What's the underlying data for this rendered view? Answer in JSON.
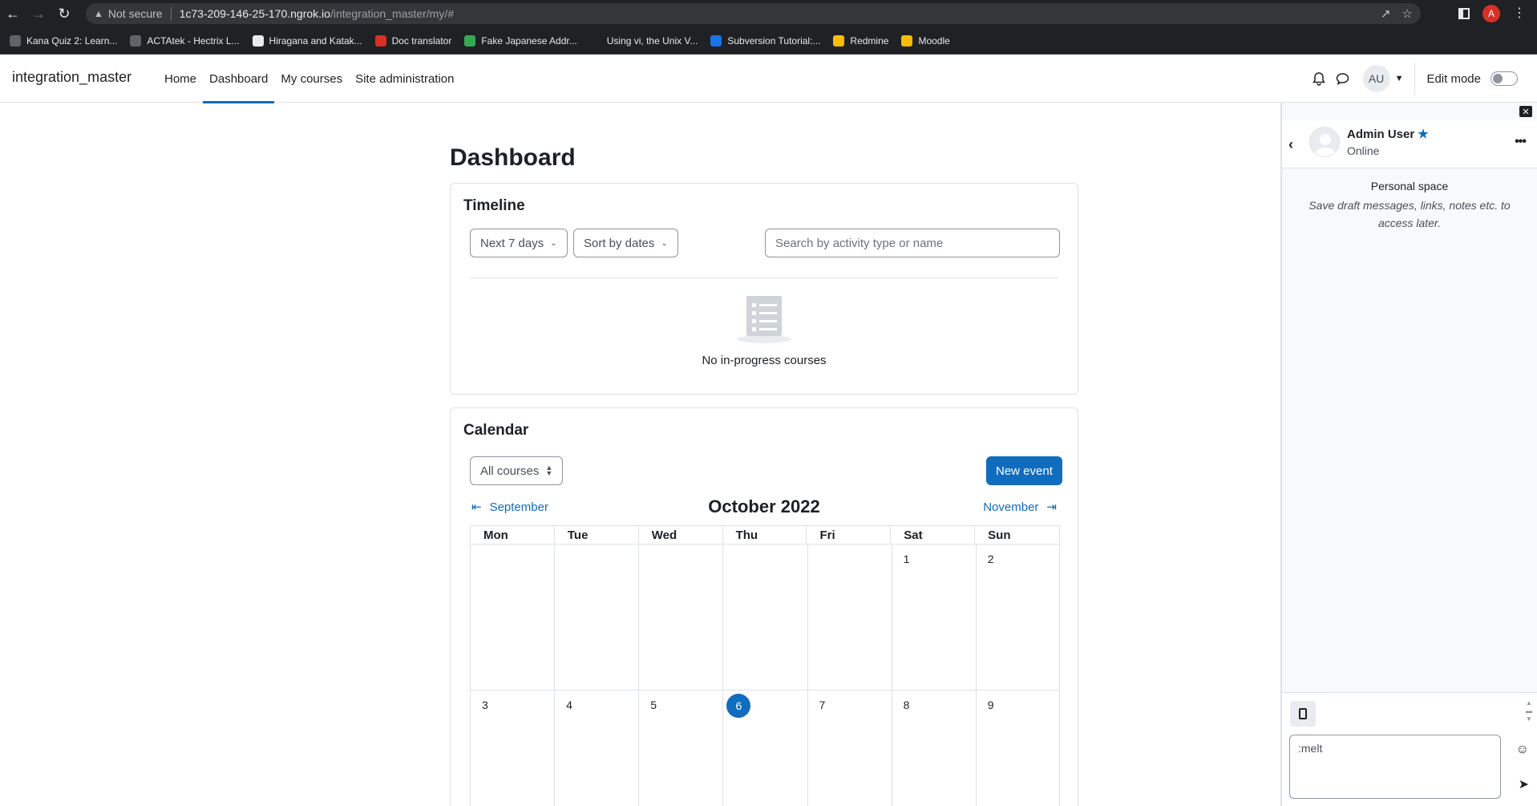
{
  "browser": {
    "not_secure": "Not secure",
    "url_host": "1c73-209-146-25-170.ngrok.io",
    "url_path": "/integration_master/my/#",
    "profile_initial": "A",
    "bookmarks": [
      {
        "label": "Kana Quiz 2: Learn...",
        "color": "#5f6368"
      },
      {
        "label": "ACTAtek - Hectrix L...",
        "color": "#5f6368"
      },
      {
        "label": "Hiragana and Katak...",
        "color": "#e8eaed"
      },
      {
        "label": "Doc translator",
        "color": "#d93025"
      },
      {
        "label": "Fake Japanese Addr...",
        "color": "#34a853"
      },
      {
        "label": "Using vi, the Unix V...",
        "color": "#202124"
      },
      {
        "label": "Subversion Tutorial:...",
        "color": "#1a73e8"
      },
      {
        "label": "Redmine",
        "color": "#fbbc04"
      },
      {
        "label": "Moodle",
        "color": "#fbbc04"
      }
    ]
  },
  "navbar": {
    "site_name": "integration_master",
    "items": [
      "Home",
      "Dashboard",
      "My courses",
      "Site administration"
    ],
    "active_index": 1,
    "avatar_initials": "AU",
    "edit_mode_label": "Edit mode"
  },
  "page": {
    "title": "Dashboard"
  },
  "timeline": {
    "title": "Timeline",
    "filter_days": "Next 7 days",
    "sort": "Sort by dates",
    "search_placeholder": "Search by activity type or name",
    "empty_text": "No in-progress courses"
  },
  "calendar": {
    "title": "Calendar",
    "course_filter": "All courses",
    "new_event": "New event",
    "prev_month": "September",
    "next_month": "November",
    "month_title": "October 2022",
    "weekdays": [
      "Mon",
      "Tue",
      "Wed",
      "Thu",
      "Fri",
      "Sat",
      "Sun"
    ],
    "weeks": [
      [
        "",
        "",
        "",
        "",
        "",
        "1",
        "2"
      ],
      [
        "3",
        "4",
        "5",
        "6",
        "7",
        "8",
        "9"
      ]
    ],
    "today": "6"
  },
  "drawer": {
    "user_name": "Admin User",
    "status": "Online",
    "personal_space_title": "Personal space",
    "personal_space_desc": "Save draft messages, links, notes etc. to access later.",
    "message_value": ":melt"
  }
}
